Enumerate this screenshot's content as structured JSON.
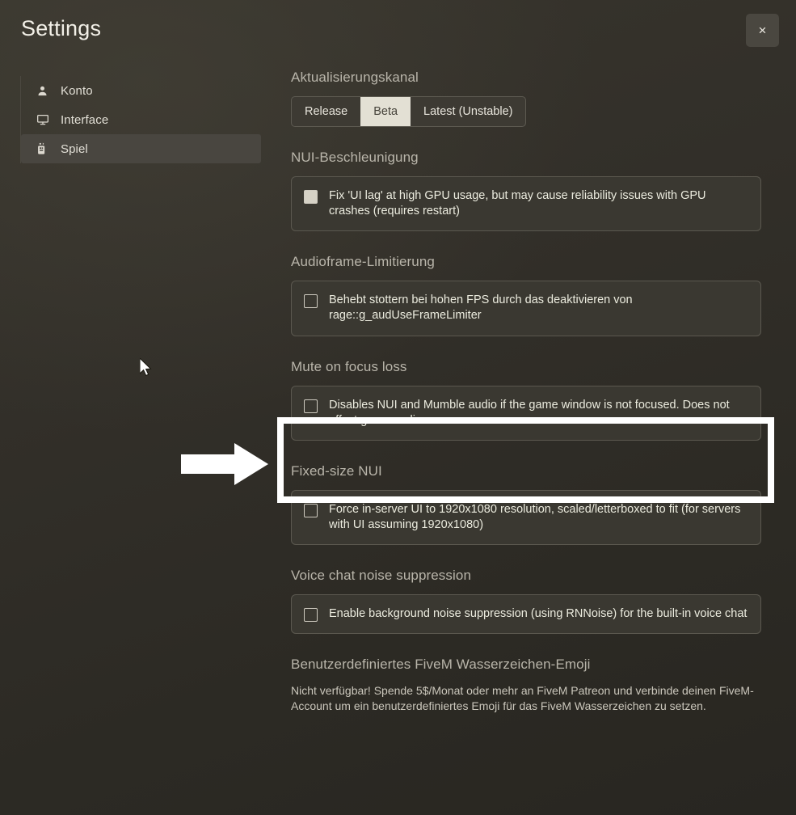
{
  "window": {
    "title": "Settings",
    "close_label": "×",
    "close_icon": "close-icon"
  },
  "sidebar": {
    "items": [
      {
        "label": "Konto",
        "icon": "person-icon",
        "active": false
      },
      {
        "label": "Interface",
        "icon": "monitor-icon",
        "active": false
      },
      {
        "label": "Spiel",
        "icon": "game-controller-icon",
        "active": true
      }
    ]
  },
  "main": {
    "update_channel": {
      "title": "Aktualisierungskanal",
      "options": [
        {
          "label": "Release",
          "selected": false
        },
        {
          "label": "Beta",
          "selected": true
        },
        {
          "label": "Latest (Unstable)",
          "selected": false
        }
      ]
    },
    "nui_acceleration": {
      "title": "NUI-Beschleunigung",
      "option_text": "Fix 'UI lag' at high GPU usage, but may cause reliability issues with GPU crashes (requires restart)",
      "checked": false,
      "highlighted": true
    },
    "audioframe_limiter": {
      "title": "Audioframe-Limitierung",
      "option_text": "Behebt stottern bei hohen FPS durch das deaktivieren von rage::g_audUseFrameLimiter",
      "checked": false,
      "highlighted": false
    },
    "mute_on_focus_loss": {
      "title": "Mute on focus loss",
      "option_text": "Disables NUI and Mumble audio if the game window is not focused. Does not affect game audio",
      "checked": false,
      "highlighted": false
    },
    "fixed_size_nui": {
      "title": "Fixed-size NUI",
      "option_text": "Force in-server UI to 1920x1080 resolution, scaled/letterboxed to fit (for servers with UI assuming 1920x1080)",
      "checked": false,
      "highlighted": false
    },
    "voice_chat_noise_suppression": {
      "title": "Voice chat noise suppression",
      "option_text": "Enable background noise suppression (using RNNoise) for the built-in voice chat",
      "checked": false,
      "highlighted": false
    },
    "watermark_emoji": {
      "title": "Benutzerdefiniertes FiveM Wasserzeichen-Emoji",
      "note": "Nicht verfügbar! Spende 5$/Monat oder mehr an FiveM Patreon und verbinde deinen FiveM-Account um ein benutzerdefiniertes Emoji für das FiveM Wasserzeichen zu setzen."
    }
  },
  "annotations": {
    "highlight_color": "#ffffff",
    "arrow_icon": "right-arrow-annotation",
    "cursor_icon": "mouse-cursor-icon"
  },
  "colors": {
    "background": "#2e2c26",
    "panel": "#3a3831",
    "panel_border": "#5b584f",
    "accent_selected": "#e3e0d4",
    "text_primary": "#ececdf",
    "text_muted": "#b9b5aa",
    "sidebar_active": "#494640"
  }
}
